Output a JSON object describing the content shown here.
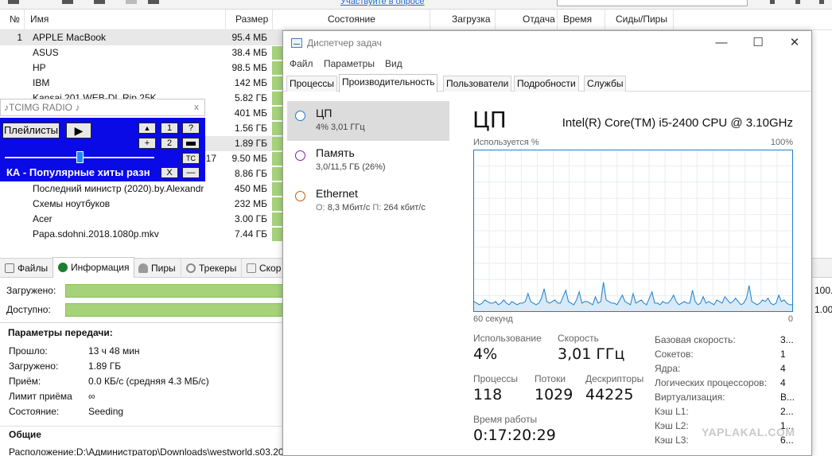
{
  "torrent": {
    "toolbar": {
      "survey_link": "Участвуйте в опросе"
    },
    "columns": {
      "num": "№",
      "name": "Имя",
      "size": "Размер",
      "status": "Состояние",
      "download": "Загрузка",
      "upload": "Отдача",
      "time": "Время",
      "seeds": "Сиды/Пиры"
    },
    "rows": [
      {
        "num": "1",
        "name": "APPLE MacBook",
        "size": "95.4 МБ"
      },
      {
        "num": "",
        "name": "ASUS",
        "size": "38.4 МБ"
      },
      {
        "num": "",
        "name": "HP",
        "size": "98.5 МБ"
      },
      {
        "num": "",
        "name": "IBM",
        "size": "142 МБ"
      },
      {
        "num": "",
        "name": "Kansai 201 WEB-DL Rip 25K ...",
        "size": "5.82 ГБ"
      },
      {
        "num": "",
        "name": "",
        "size": "401 МБ"
      },
      {
        "num": "",
        "name": "",
        "size": "1.56 ГБ"
      },
      {
        "num": "",
        "name": "",
        "size": "1.89 ГБ"
      },
      {
        "num": "",
        "name": "017",
        "size": "9.50 МБ"
      },
      {
        "num": "",
        "name": "",
        "size": "8.86 ГБ"
      },
      {
        "num": "",
        "name": "Последний министр (2020).by.Alexandr",
        "size": "450 МБ"
      },
      {
        "num": "",
        "name": "Схемы ноутбуков",
        "size": "232 МБ"
      },
      {
        "num": "",
        "name": "Acer",
        "size": "3.00 ГБ"
      },
      {
        "num": "",
        "name": "Papa.sdohni.2018.1080p.mkv",
        "size": "7.44 ГБ"
      }
    ],
    "tabs": [
      "Файлы",
      "Информация",
      "Пиры",
      "Трекеры",
      "Скор"
    ],
    "info": {
      "downloaded_label": "Загружено:",
      "available_label": "Доступно:",
      "downloaded_value": "100.",
      "available_value": "1.00",
      "downloaded_fraction": 1.0,
      "available_fraction": 1.0
    },
    "params": {
      "title": "Параметры передачи:",
      "rows": [
        {
          "label": "Прошло:",
          "value": "13 ч 48 мин"
        },
        {
          "label": "Загружено:",
          "value": "1.89 ГБ"
        },
        {
          "label": "Приём:",
          "value": "0.0 КБ/с (средняя 4.3 МБ/с)"
        },
        {
          "label": "Лимит приёма",
          "value": "∞"
        },
        {
          "label": "Состояние:",
          "value": "Seeding"
        }
      ],
      "general_title": "Общие",
      "location": "Расположение:D:\\Администратор\\Downloads\\westworld.s03.20"
    }
  },
  "radio": {
    "title": "♪TCIMG RADIO ♪",
    "close": "x",
    "playlists_button": "Плейлисты",
    "play_symbol": "▶",
    "up_symbol": "▲",
    "plus_symbol": "+",
    "btn_1": "1",
    "btn_2": "2",
    "btn_help": "?",
    "btn_tc": "TC",
    "btn_x": "X",
    "btn_min": "—",
    "station": "КА - Популярные хиты разн",
    "volume_fraction": 0.5
  },
  "taskmgr": {
    "title": "Диспетчер задач",
    "window_buttons": {
      "minimize": "—",
      "maximize": "☐",
      "close": "✕"
    },
    "menu": [
      "Файл",
      "Параметры",
      "Вид"
    ],
    "tabs": [
      "Процессы",
      "Производительность",
      "Пользователи",
      "Подробности",
      "Службы"
    ],
    "active_tab": "Производительность",
    "sidebar": [
      {
        "name": "ЦП",
        "sub": "4% 3,01 ГГц",
        "color": "#1f7ad1"
      },
      {
        "name": "Память",
        "sub": "3,0/11,5 ГБ (26%)",
        "color": "#8b1fa8"
      },
      {
        "name": "Ethernet",
        "sub_prefix_send": "О:",
        "sub_send": "8,3 Мбит/с",
        "sub_prefix_recv": "П:",
        "sub_recv": "264 кбит/с",
        "color": "#c15b12"
      }
    ],
    "cpu": {
      "heading": "ЦП",
      "model": "Intel(R) Core(TM) i5-2400 CPU @ 3.10GHz",
      "graph_label_left": "Используется %",
      "graph_label_right": "100%",
      "graph_time_left": "60 секунд",
      "graph_time_right": "0",
      "graph_color": "#1d7fc9",
      "usage_history": [
        6,
        5,
        4,
        5,
        7,
        6,
        5,
        5,
        6,
        4,
        5,
        7,
        5,
        4,
        6,
        5,
        4,
        5,
        5,
        6,
        11,
        6,
        5,
        4,
        5,
        8,
        14,
        6,
        5,
        6,
        7,
        5,
        5,
        9,
        13,
        6,
        5,
        4,
        7,
        12,
        5,
        6,
        6,
        5,
        4,
        9,
        5,
        6,
        18,
        7,
        6,
        5,
        5,
        4,
        7,
        10,
        6,
        5,
        4,
        11,
        5,
        6,
        7,
        5,
        4,
        8,
        12,
        5,
        5,
        4,
        6,
        5,
        5,
        7,
        10,
        6,
        4,
        5,
        6,
        5,
        5,
        13,
        6,
        4,
        5,
        9,
        5,
        6,
        5,
        4,
        7,
        6,
        5,
        9,
        7,
        5,
        6,
        8,
        6,
        4,
        5,
        8,
        16,
        6,
        5,
        4,
        5,
        7,
        6,
        8,
        5,
        4,
        5,
        10,
        6,
        7,
        5,
        4,
        4
      ],
      "stats": {
        "usage_label": "Использование",
        "usage_value": "4%",
        "speed_label": "Скорость",
        "speed_value": "3,01 ГГц",
        "processes_label": "Процессы",
        "processes_value": "118",
        "threads_label": "Потоки",
        "threads_value": "1029",
        "handles_label": "Дескрипторы",
        "handles_value": "44225",
        "uptime_label": "Время работы",
        "uptime_value": "0:17:20:29"
      },
      "specs": [
        {
          "k": "Базовая скорость:",
          "v": "3..."
        },
        {
          "k": "Сокетов:",
          "v": "1"
        },
        {
          "k": "Ядра:",
          "v": "4"
        },
        {
          "k": "Логических процессоров:",
          "v": "4"
        },
        {
          "k": "Виртуализация:",
          "v": "В..."
        },
        {
          "k": "Кэш L1:",
          "v": "2..."
        },
        {
          "k": "Кэш L2:",
          "v": "1..."
        },
        {
          "k": "Кэш L3:",
          "v": "6..."
        }
      ]
    }
  },
  "watermark": "YAPLAKAL.COM"
}
